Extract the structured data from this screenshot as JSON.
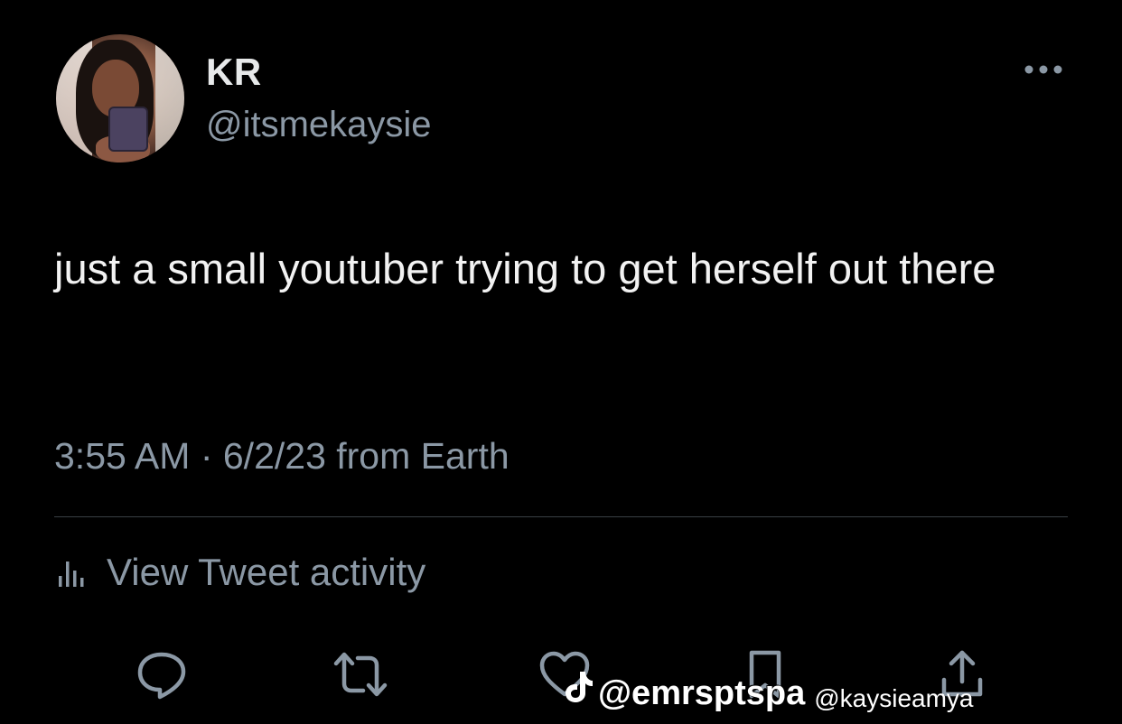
{
  "tweet": {
    "author": {
      "display_name": "KR",
      "handle": "@itsmekaysie"
    },
    "text": "just a small youtuber trying to get herself out there",
    "meta": {
      "time": "3:55 AM",
      "separator": " · ",
      "date": "6/2/23",
      "source": " from Earth"
    },
    "activity_label": "View Tweet activity"
  },
  "icons": {
    "more": "more-horizontal-icon",
    "activity": "bar-chart-icon",
    "reply": "reply-bubble-icon",
    "retweet": "retweet-icon",
    "like": "heart-icon",
    "bookmark": "bookmark-icon",
    "share": "share-upload-icon"
  },
  "watermark": {
    "user": "@emrsptspa",
    "user2": "@kaysieamya"
  },
  "colors": {
    "background": "#000000",
    "primary_text": "#e7e9ea",
    "secondary_text": "#8b98a5",
    "divider": "#3a3f44"
  }
}
